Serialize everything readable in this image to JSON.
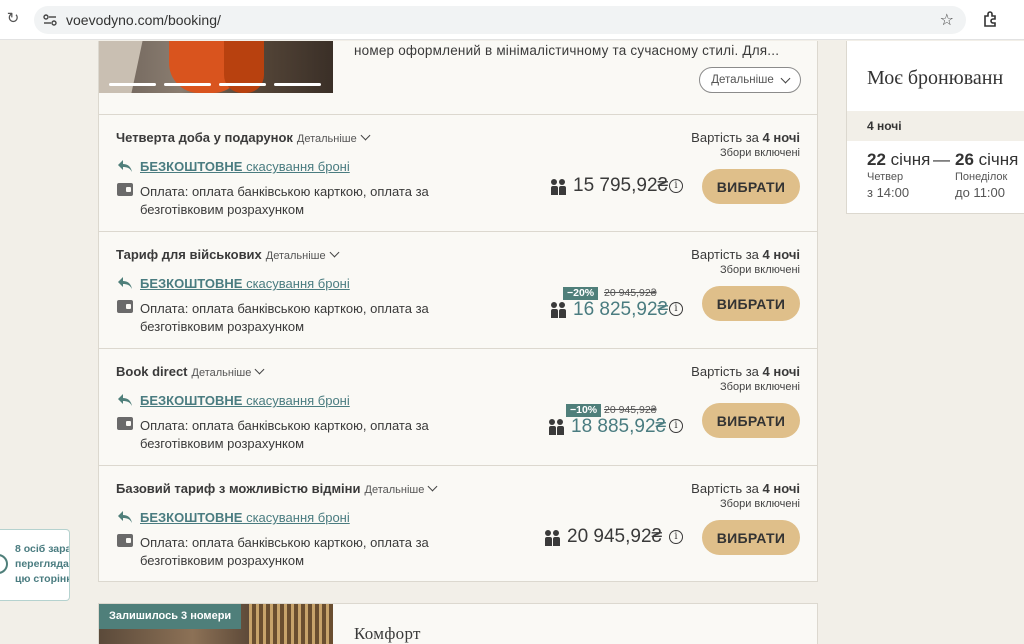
{
  "browser": {
    "url": "voevodyno.com/booking/"
  },
  "room": {
    "description": "номер оформлений в мінімалістичному та сучасному стилі. Для...",
    "details_button": "Детальніше"
  },
  "rates": [
    {
      "title": "Четверта доба у подарунок",
      "details": "Детальніше",
      "cancel_bold": "БЕЗКОШТОВНЕ",
      "cancel_rest": " скасування броні",
      "payment": "Оплата: оплата банківською карткою, оплата за безготівковим розрахунком",
      "cost_label": "Вартість за ",
      "cost_nights": "4 ночі",
      "fees": "Збори включені",
      "price": "15 795,92₴",
      "discount": "",
      "old_price": "",
      "button": "ВИБРАТИ"
    },
    {
      "title": "Тариф для військових",
      "details": "Детальніше",
      "cancel_bold": "БЕЗКОШТОВНЕ",
      "cancel_rest": " скасування броні",
      "payment": "Оплата: оплата банківською карткою, оплата за безготівковим розрахунком",
      "cost_label": "Вартість за ",
      "cost_nights": "4 ночі",
      "fees": "Збори включені",
      "price": "16 825,92₴",
      "discount": "−20%",
      "old_price": "20 945,92₴",
      "button": "ВИБРАТИ"
    },
    {
      "title": "Book direct",
      "details": "Детальніше",
      "cancel_bold": "БЕЗКОШТОВНЕ",
      "cancel_rest": " скасування броні",
      "payment": "Оплата: оплата банківською карткою, оплата за безготівковим розрахунком",
      "cost_label": "Вартість за ",
      "cost_nights": "4 ночі",
      "fees": "Збори включені",
      "price": "18 885,92₴",
      "discount": "−10%",
      "old_price": "20 945,92₴",
      "button": "ВИБРАТИ"
    },
    {
      "title": "Базовий тариф з можливістю відміни",
      "details": "Детальніше",
      "cancel_bold": "БЕЗКОШТОВНЕ",
      "cancel_rest": " скасування броні",
      "payment": "Оплата: оплата банківською карткою, оплата за безготівковим розрахунком",
      "cost_label": "Вартість за ",
      "cost_nights": "4 ночі",
      "fees": "Збори включені",
      "price": "20 945,92₴",
      "discount": "",
      "old_price": "",
      "button": "ВИБРАТИ"
    }
  ],
  "booking": {
    "title": "Моє бронюванн",
    "nights": "4 ночі",
    "checkin_day": "22",
    "checkin_month": " січня",
    "checkout_day": "26",
    "checkout_month": " січня",
    "dash": "—",
    "checkin_weekday": "Четвер",
    "checkin_time": "з 14:00",
    "checkout_weekday": "Понеділок",
    "checkout_time": "до 11:00"
  },
  "toast": {
    "line1": "8 осіб зара",
    "line2": "переглядаю",
    "line3": "цю сторінк"
  },
  "next_room": {
    "remaining": "Залишилось 3 номери",
    "title": "Комфорт"
  },
  "colors": {
    "accent_teal": "#4a7c80",
    "button_gold": "#dfbf8a",
    "background": "#f2efe8"
  }
}
